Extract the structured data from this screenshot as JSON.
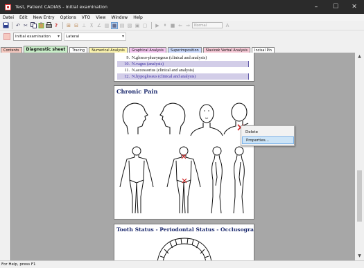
{
  "window": {
    "title": "Test, Patient CADIAS - Initial examination",
    "controls": {
      "minimize": "–",
      "maximize": "☐",
      "close": "✕"
    }
  },
  "menu": [
    "Datei",
    "Edit",
    "New Entry",
    "Options",
    "VTO",
    "View",
    "Window",
    "Help"
  ],
  "toolbar": {
    "icons": [
      "save-icon",
      "undo-icon",
      "cut-icon",
      "copy-icon",
      "paste-icon",
      "print-icon",
      "help-icon"
    ],
    "format_combo": "Normal"
  },
  "selectors": {
    "examination": "Initial examination",
    "view": "Lateral"
  },
  "tabs": [
    {
      "label": "Contents",
      "color": "#f6c9c0"
    },
    {
      "label": "Diagnostic sheet",
      "color": "#c8eec8",
      "active": true
    },
    {
      "label": "Tracing",
      "color": "#ffffff"
    },
    {
      "label": "Numerical Analysis",
      "color": "#fff7b0"
    },
    {
      "label": "Graphical Analysis",
      "color": "#f4c6ef"
    },
    {
      "label": "Superimposition",
      "color": "#c9d8fb"
    },
    {
      "label": "Slavicek Verbal Analysis",
      "color": "#f6c9d6"
    },
    {
      "label": "Incisal Pin",
      "color": "#ffffff"
    }
  ],
  "nerves": [
    {
      "num": "9.",
      "label": "N.glosso-pharyngeus (clinical and analysis)",
      "highlight": false
    },
    {
      "num": "10.",
      "label": "N.vagus (analysis)",
      "highlight": true
    },
    {
      "num": "11.",
      "label": "N.accessorius (clinical and analysis)",
      "highlight": false
    },
    {
      "num": "12.",
      "label": "N.hypoglossus (clinical and analysis)",
      "highlight": true
    }
  ],
  "sections": {
    "chronic_pain": "Chronic Pain",
    "tooth_status": "Tooth Status - Periodontal Status - Occlusogram"
  },
  "context_menu": {
    "items": [
      {
        "label": "Delete",
        "highlight": false
      },
      {
        "label": "Properties...",
        "highlight": true
      }
    ]
  },
  "status": "For Help, press F1",
  "colors": {
    "accent_title": "#1c2a6e",
    "pain_mark": "#cc2222",
    "highlight": "#d2cde8"
  }
}
